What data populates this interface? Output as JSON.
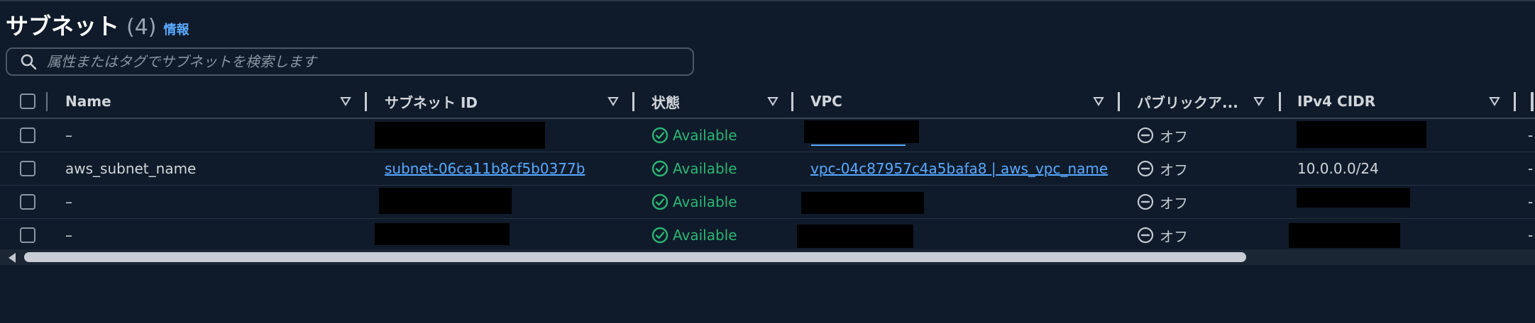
{
  "header": {
    "title": "サブネット",
    "count": "(4)",
    "info_link": "情報"
  },
  "search": {
    "placeholder": "属性またはタグでサブネットを検索します",
    "value": ""
  },
  "table": {
    "columns": [
      {
        "key": "name",
        "label": "Name"
      },
      {
        "key": "subnet_id",
        "label": "サブネット ID"
      },
      {
        "key": "state",
        "label": "状態"
      },
      {
        "key": "vpc",
        "label": "VPC"
      },
      {
        "key": "public_ip",
        "label": "パブリックア..."
      },
      {
        "key": "ipv4_cidr",
        "label": "IPv4 CIDR"
      }
    ],
    "rows": [
      {
        "name": "–",
        "subnet_id": "",
        "state": "Available",
        "vpc": "",
        "public_ip": "オフ",
        "ipv4_cidr": "",
        "extra": "-"
      },
      {
        "name": "aws_subnet_name",
        "subnet_id": "subnet-06ca11b8cf5b0377b",
        "state": "Available",
        "vpc": "vpc-04c87957c4a5bafa8 | aws_vpc_name",
        "public_ip": "オフ",
        "ipv4_cidr": "10.0.0.0/24",
        "extra": "-"
      },
      {
        "name": "–",
        "subnet_id": "",
        "state": "Available",
        "vpc": "",
        "public_ip": "オフ",
        "ipv4_cidr": "",
        "extra": "-"
      },
      {
        "name": "–",
        "subnet_id": "",
        "state": "Available",
        "vpc": "",
        "public_ip": "オフ",
        "ipv4_cidr": "",
        "extra": "-"
      }
    ]
  },
  "icons": {
    "search": "search-icon",
    "sort": "sort-down-triangle-icon",
    "status": "check-circle-icon",
    "off": "minus-circle-icon"
  },
  "colors": {
    "background": "#0f1b2a",
    "accent_link": "#5aa9ff",
    "available": "#2bb673",
    "muted": "#9aa4b2"
  }
}
